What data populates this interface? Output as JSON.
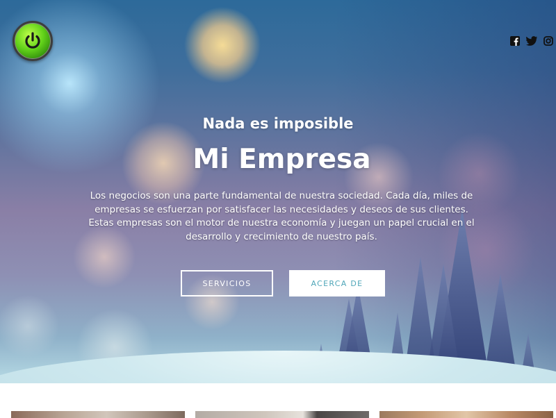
{
  "header": {
    "logo_icon": "power-button-icon",
    "social_links": [
      {
        "name": "facebook",
        "icon": "facebook-icon"
      },
      {
        "name": "twitter",
        "icon": "twitter-icon"
      },
      {
        "name": "instagram",
        "icon": "instagram-icon"
      }
    ]
  },
  "hero": {
    "tagline": "Nada es imposible",
    "title": "Mi Empresa",
    "description": "Los negocios son una parte fundamental de nuestra sociedad. Cada día, miles de empresas se esfuerzan por satisfacer las necesidades y deseos de sus clientes. Estas empresas son el motor de nuestra economía y juegan un papel crucial en el desarrollo y crecimiento de nuestro país.",
    "buttons": {
      "services_label": "SERVICIOS",
      "about_label": "ACERCA DE"
    }
  },
  "colors": {
    "accent": "#4fa6b8",
    "logo_green": "#62d21a",
    "icon_dark": "#111111"
  }
}
